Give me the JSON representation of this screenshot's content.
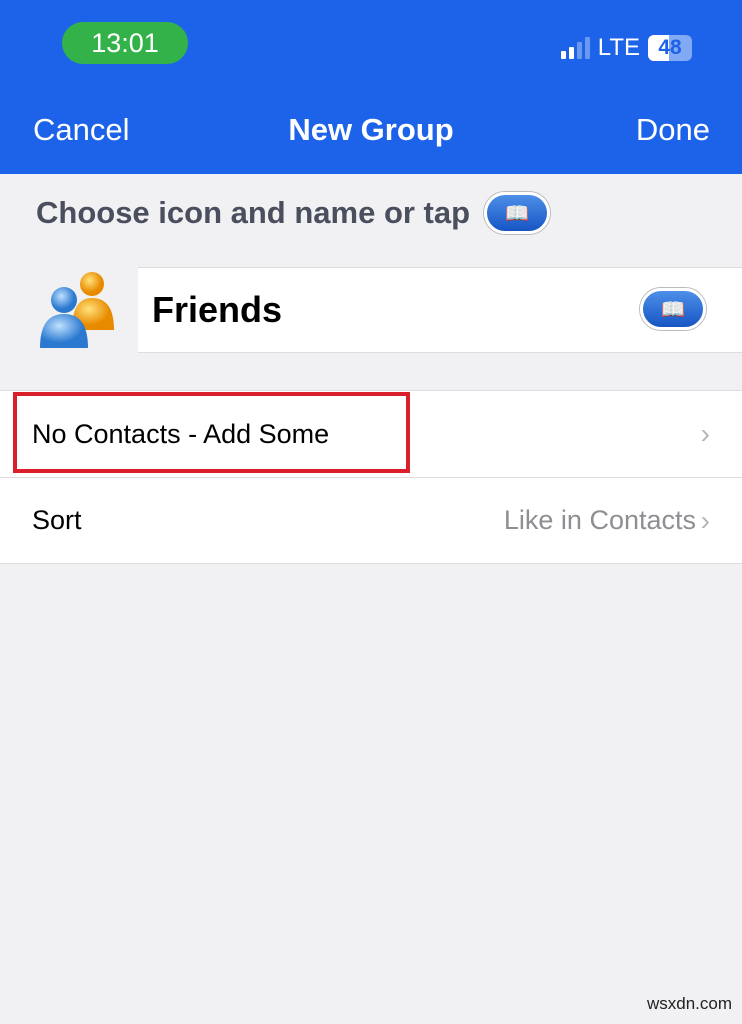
{
  "status_bar": {
    "time": "13:01",
    "network": "LTE",
    "battery": "48",
    "signal_bars": 2,
    "signal_max": 4
  },
  "nav": {
    "cancel": "Cancel",
    "title": "New Group",
    "done": "Done"
  },
  "hint": {
    "text": "Choose icon and name or tap",
    "icon": "book-icon"
  },
  "group": {
    "icon": "people-icon",
    "name": "Friends",
    "picker_icon": "book-icon"
  },
  "rows": [
    {
      "label": "No Contacts - Add Some",
      "value": "",
      "highlighted": true,
      "highlight_color": "#d9202a"
    },
    {
      "label": "Sort",
      "value": "Like in Contacts"
    }
  ],
  "colors": {
    "header": "#1d63e9",
    "time_pill": "#34b24a"
  },
  "watermark": "wsxdn.com"
}
